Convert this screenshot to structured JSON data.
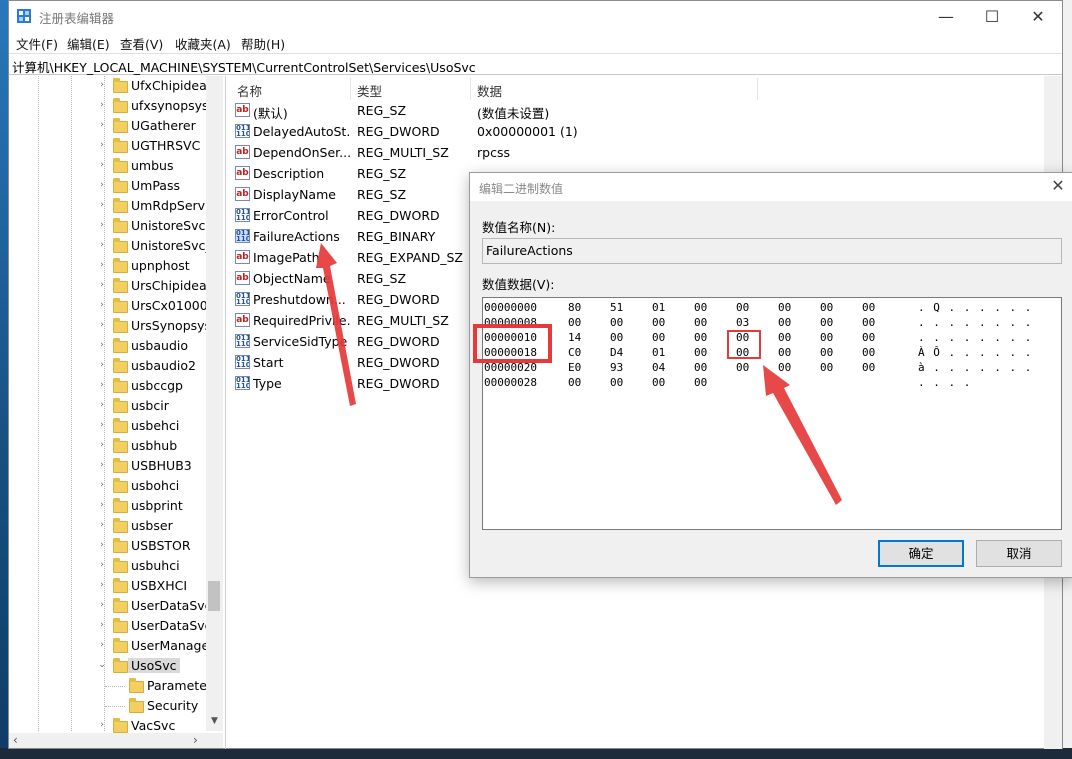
{
  "window": {
    "title": "注册表编辑器",
    "minimize": "—",
    "maximize": "☐",
    "close": "✕"
  },
  "menu": [
    "文件(F)",
    "编辑(E)",
    "查看(V)",
    "收藏夹(A)",
    "帮助(H)"
  ],
  "address": "计算机\\HKEY_LOCAL_MACHINE\\SYSTEM\\CurrentControlSet\\Services\\UsoSvc",
  "tree": {
    "items": [
      {
        "label": "UfxChipidea"
      },
      {
        "label": "ufxsynopsys"
      },
      {
        "label": "UGatherer"
      },
      {
        "label": "UGTHRSVC"
      },
      {
        "label": "umbus"
      },
      {
        "label": "UmPass"
      },
      {
        "label": "UmRdpServic"
      },
      {
        "label": "UnistoreSvc"
      },
      {
        "label": "UnistoreSvc_"
      },
      {
        "label": "upnphost"
      },
      {
        "label": "UrsChipidea"
      },
      {
        "label": "UrsCx01000"
      },
      {
        "label": "UrsSynopsys"
      },
      {
        "label": "usbaudio"
      },
      {
        "label": "usbaudio2"
      },
      {
        "label": "usbccgp"
      },
      {
        "label": "usbcir"
      },
      {
        "label": "usbehci"
      },
      {
        "label": "usbhub"
      },
      {
        "label": "USBHUB3"
      },
      {
        "label": "usbohci"
      },
      {
        "label": "usbprint"
      },
      {
        "label": "usbser"
      },
      {
        "label": "USBSTOR"
      },
      {
        "label": "usbuhci"
      },
      {
        "label": "USBXHCI"
      },
      {
        "label": "UserDataSvc"
      },
      {
        "label": "UserDataSvc_"
      },
      {
        "label": "UserManage"
      },
      {
        "label": "UsoSvc"
      },
      {
        "label": "Parameter"
      },
      {
        "label": "Security"
      },
      {
        "label": "VacSvc"
      }
    ]
  },
  "values": {
    "headers": {
      "name": "名称",
      "type": "类型",
      "data": "数据"
    },
    "rows": [
      {
        "icon": "ab",
        "name": "(默认)",
        "type": "REG_SZ",
        "data": "(数值未设置)"
      },
      {
        "icon": "bin",
        "name": "DelayedAutoSt...",
        "type": "REG_DWORD",
        "data": "0x00000001 (1)"
      },
      {
        "icon": "ab",
        "name": "DependOnSer...",
        "type": "REG_MULTI_SZ",
        "data": "rpcss"
      },
      {
        "icon": "ab",
        "name": "Description",
        "type": "REG_SZ",
        "data": ""
      },
      {
        "icon": "ab",
        "name": "DisplayName",
        "type": "REG_SZ",
        "data": ""
      },
      {
        "icon": "bin",
        "name": "ErrorControl",
        "type": "REG_DWORD",
        "data": ""
      },
      {
        "icon": "bin",
        "name": "FailureActions",
        "type": "REG_BINARY",
        "data": ""
      },
      {
        "icon": "ab",
        "name": "ImagePath",
        "type": "REG_EXPAND_SZ",
        "data": ""
      },
      {
        "icon": "ab",
        "name": "ObjectName",
        "type": "REG_SZ",
        "data": ""
      },
      {
        "icon": "bin",
        "name": "Preshutdown...",
        "type": "REG_DWORD",
        "data": ""
      },
      {
        "icon": "ab",
        "name": "RequiredPrivile...",
        "type": "REG_MULTI_SZ",
        "data": ""
      },
      {
        "icon": "bin",
        "name": "ServiceSidType",
        "type": "REG_DWORD",
        "data": ""
      },
      {
        "icon": "bin",
        "name": "Start",
        "type": "REG_DWORD",
        "data": ""
      },
      {
        "icon": "bin",
        "name": "Type",
        "type": "REG_DWORD",
        "data": ""
      }
    ]
  },
  "dialog": {
    "title": "编辑二进制数值",
    "close": "✕",
    "name_label": "数值名称(N):",
    "name_value": "FailureActions",
    "data_label": "数值数据(V):",
    "hex_rows": [
      {
        "offset": "00000000",
        "bytes": [
          "80",
          "51",
          "01",
          "00",
          "00",
          "00",
          "00",
          "00"
        ],
        "ascii": ". Q . . . . . ."
      },
      {
        "offset": "00000008",
        "bytes": [
          "00",
          "00",
          "00",
          "00",
          "03",
          "00",
          "00",
          "00"
        ],
        "ascii": ". . . . . . . ."
      },
      {
        "offset": "00000010",
        "bytes": [
          "14",
          "00",
          "00",
          "00",
          "00",
          "00",
          "00",
          "00"
        ],
        "ascii": ". . . . . . . ."
      },
      {
        "offset": "00000018",
        "bytes": [
          "C0",
          "D4",
          "01",
          "00",
          "00",
          "00",
          "00",
          "00"
        ],
        "ascii": "À Ô . . . . . ."
      },
      {
        "offset": "00000020",
        "bytes": [
          "E0",
          "93",
          "04",
          "00",
          "00",
          "00",
          "00",
          "00"
        ],
        "ascii": "à . . . . . . ."
      },
      {
        "offset": "00000028",
        "bytes": [
          "00",
          "00",
          "00",
          "00"
        ],
        "ascii": ". . . ."
      }
    ],
    "ok": "确定",
    "cancel": "取消"
  },
  "colors": {
    "annotation": "#e53a3a",
    "selection": "#d9d9d9",
    "desktop": "#1f6fb0"
  }
}
